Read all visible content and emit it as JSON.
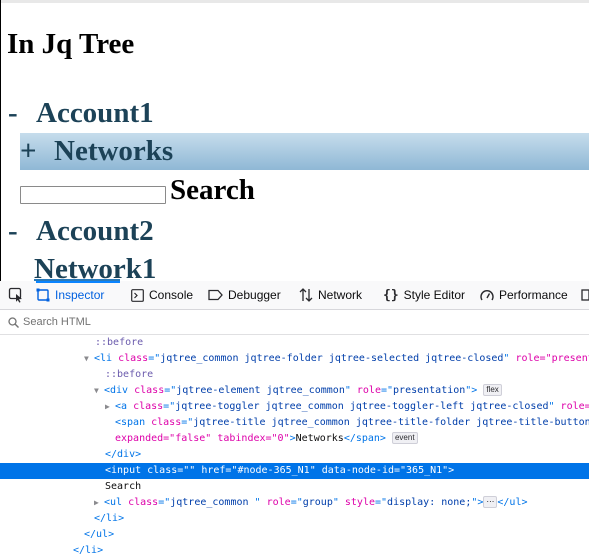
{
  "page": {
    "heading": "In Jq Tree",
    "tree": {
      "account1": {
        "toggler": "-",
        "label": "Account1"
      },
      "networks": {
        "toggler": "+",
        "label": "Networks"
      },
      "search_label": "Search",
      "account2": {
        "toggler": "-",
        "label": "Account2"
      },
      "network1": {
        "label": "Network1"
      }
    }
  },
  "devtools": {
    "tabs": {
      "inspector": "Inspector",
      "console": "Console",
      "debugger": "Debugger",
      "network": "Network",
      "style_editor": "Style Editor",
      "performance": "Performance"
    },
    "search_placeholder": "Search HTML",
    "markup": {
      "l1_before": "::before",
      "l2_li_class": "jqtree_common jqtree-folder jqtree-selected jqtree-closed",
      "l2_role_attr": "role=\"present",
      "l3_before": "::before",
      "l4_div_class": "jqtree-element jqtree_common",
      "l4_role": "presentation",
      "l4_badge": "flex",
      "l5_a_class": "jqtree-toggler jqtree_common jqtree-toggler-left jqtree-closed",
      "l5_role_attr": "role=",
      "l6_span_class": "jqtree-title jqtree_common jqtree-title-folder jqtree-title-button",
      "l7_expanded": "expanded=\"false\" tabindex=\"0\"",
      "l7_text": "Networks",
      "l7_badge": "event",
      "l8_close_div": "</div>",
      "l9_selected": "<input class=\"\" href=\"#node-365_N1\" data-node-id=\"365_N1\">",
      "l10_text": "Search",
      "l11_ul_class": "jqtree_common ",
      "l11_role": "group",
      "l11_style": "display: none;",
      "l11_badge": "⋯",
      "l12_close_li": "</li>",
      "l13_close_ul": "</ul>",
      "l14_close_li": "</li>"
    }
  },
  "colors": {
    "tree_text": "#1c4257",
    "selected_row": "#0074e8",
    "inspector_tab": "#0060df"
  }
}
